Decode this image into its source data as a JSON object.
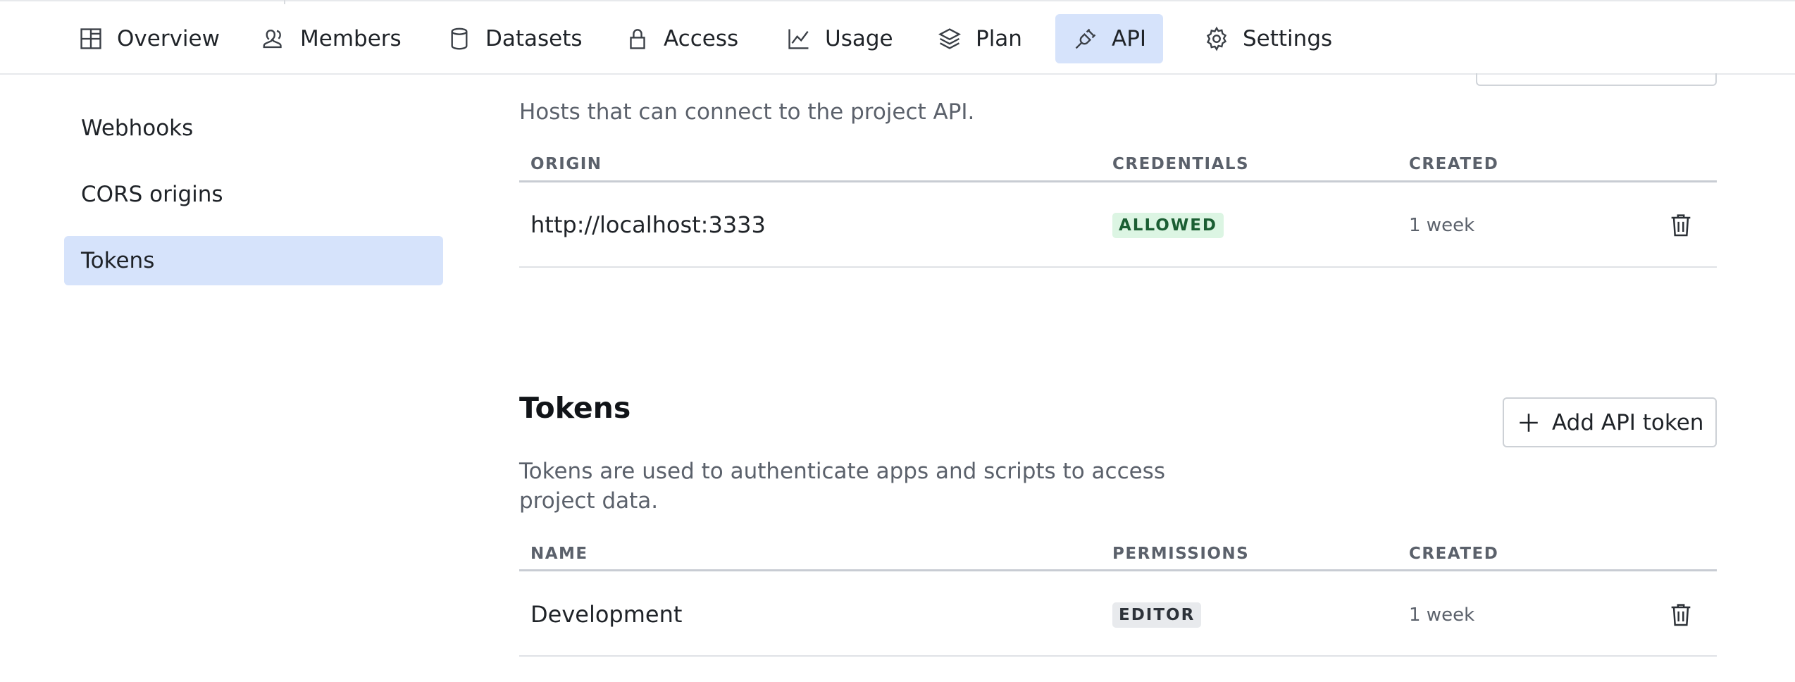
{
  "nav": {
    "tabs": [
      {
        "label": "Overview",
        "icon": "layout-icon"
      },
      {
        "label": "Members",
        "icon": "user-icon"
      },
      {
        "label": "Datasets",
        "icon": "database-icon"
      },
      {
        "label": "Access",
        "icon": "lock-icon"
      },
      {
        "label": "Usage",
        "icon": "chart-line-icon"
      },
      {
        "label": "Plan",
        "icon": "layers-icon"
      },
      {
        "label": "API",
        "icon": "plug-icon",
        "active": true
      },
      {
        "label": "Settings",
        "icon": "gear-icon"
      }
    ]
  },
  "sidebar": {
    "items": [
      {
        "label": "Webhooks"
      },
      {
        "label": "CORS origins"
      },
      {
        "label": "Tokens",
        "active": true
      }
    ]
  },
  "cors": {
    "description": "Hosts that can connect to the project API.",
    "columns": [
      "ORIGIN",
      "CREDENTIALS",
      "CREATED"
    ],
    "rows": [
      {
        "origin": "http://localhost:3333",
        "credentials": "ALLOWED",
        "created": "1 week"
      }
    ]
  },
  "tokens": {
    "title": "Tokens",
    "add_button_label": "Add API token",
    "description_line1": "Tokens are used to authenticate apps and scripts to access",
    "description_line2": "project data.",
    "columns": [
      "NAME",
      "PERMISSIONS",
      "CREATED"
    ],
    "rows": [
      {
        "name": "Development",
        "permissions": "EDITOR",
        "created": "1 week"
      }
    ]
  },
  "colors": {
    "active_bg": "#d6e3fb",
    "allowed_badge_bg": "#dcf5e3",
    "allowed_badge_text": "#1b5e33",
    "editor_badge_bg": "#e8eaed"
  }
}
